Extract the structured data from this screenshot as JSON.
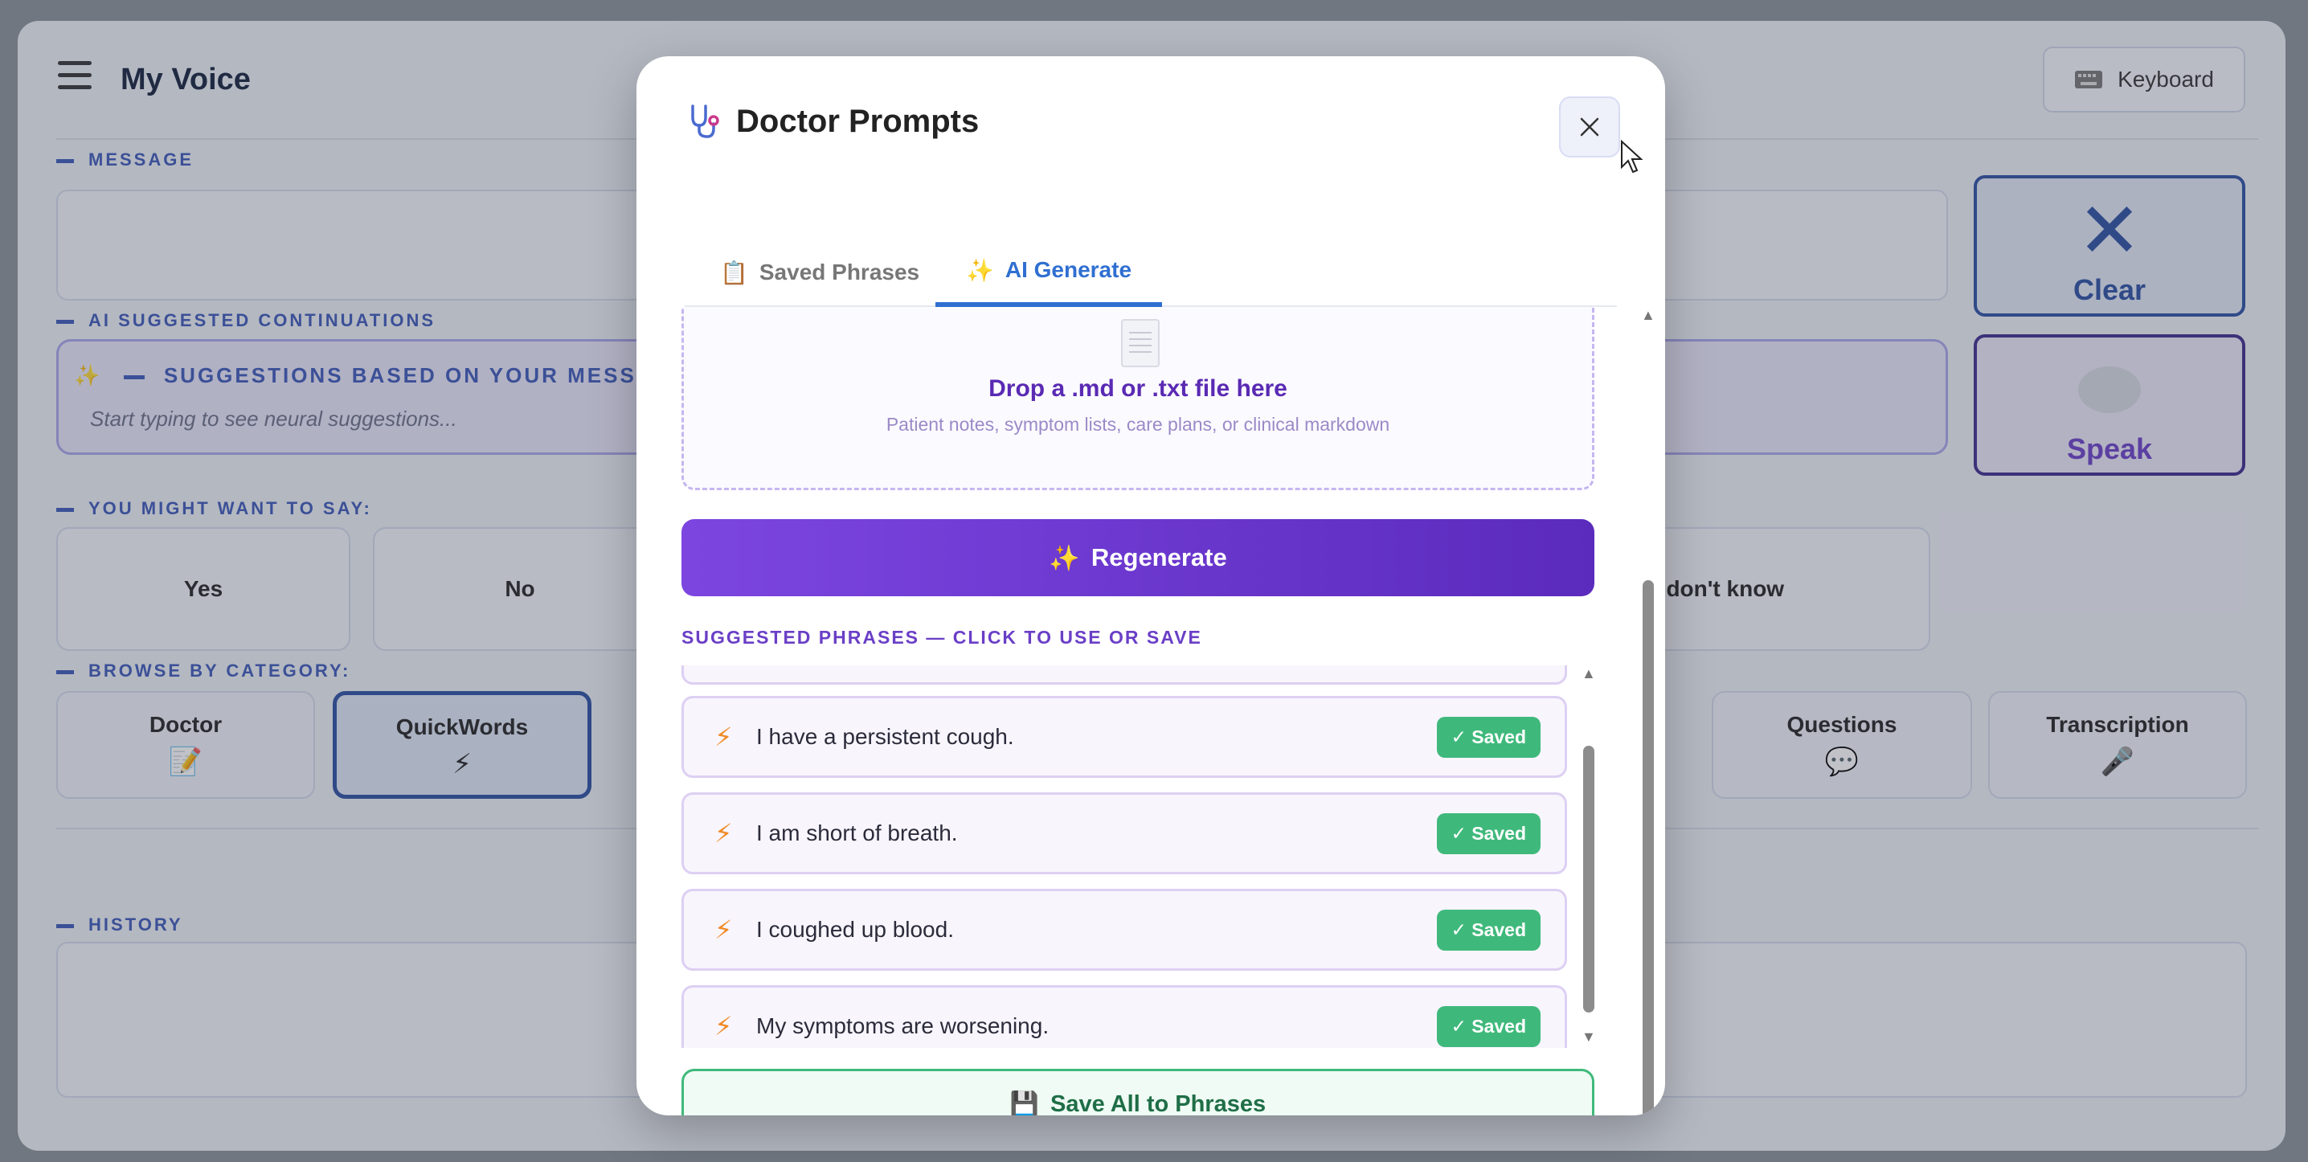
{
  "app": {
    "title": "My Voice",
    "keyboard_label": "Keyboard",
    "sections": {
      "message": "MESSAGE",
      "ai_suggested": "AI SUGGESTED CONTINUATIONS",
      "you_might_say": "YOU MIGHT WANT TO SAY:",
      "browse": "BROWSE BY CATEGORY:",
      "history": "HISTORY"
    },
    "suggestions_heading": "SUGGESTIONS BASED ON YOUR MESSA",
    "suggestions_placeholder": "Start typing to see neural suggestions...",
    "quick_replies": [
      "Yes",
      "No",
      "I don't know"
    ],
    "categories": [
      {
        "label": "Doctor",
        "icon": "📝"
      },
      {
        "label": "QuickWords",
        "icon": "⚡"
      },
      {
        "label": "Questions",
        "icon": "💬"
      },
      {
        "label": "Transcription",
        "icon": "🎤"
      }
    ],
    "clear_label": "Clear",
    "speak_label": "Speak"
  },
  "modal": {
    "title": "Doctor Prompts",
    "title_icon": "stethoscope-icon",
    "tabs": [
      {
        "label": "Saved Phrases",
        "icon": "📋",
        "active": false
      },
      {
        "label": "AI Generate",
        "icon": "✨",
        "active": true
      }
    ],
    "dropzone": {
      "title": "Drop a .md or .txt file here",
      "subtitle": "Patient notes, symptom lists, care plans, or clinical markdown"
    },
    "regenerate_label": "Regenerate",
    "regenerate_icon": "✨",
    "suggested_label": "SUGGESTED PHRASES — CLICK TO USE OR SAVE",
    "phrases": [
      {
        "text": "I have a persistent cough.",
        "badge": "✓ Saved"
      },
      {
        "text": "I am short of breath.",
        "badge": "✓ Saved"
      },
      {
        "text": "I coughed up blood.",
        "badge": "✓ Saved"
      },
      {
        "text": "My symptoms are worsening.",
        "badge": "✓ Saved"
      }
    ],
    "save_all_label": "Save All to Phrases",
    "save_all_icon": "💾"
  },
  "colors": {
    "accent_purple": "#6a3fc7",
    "tab_active": "#2f6fd1",
    "saved_green": "#3fb97b",
    "app_blue": "#2b4fa3"
  }
}
